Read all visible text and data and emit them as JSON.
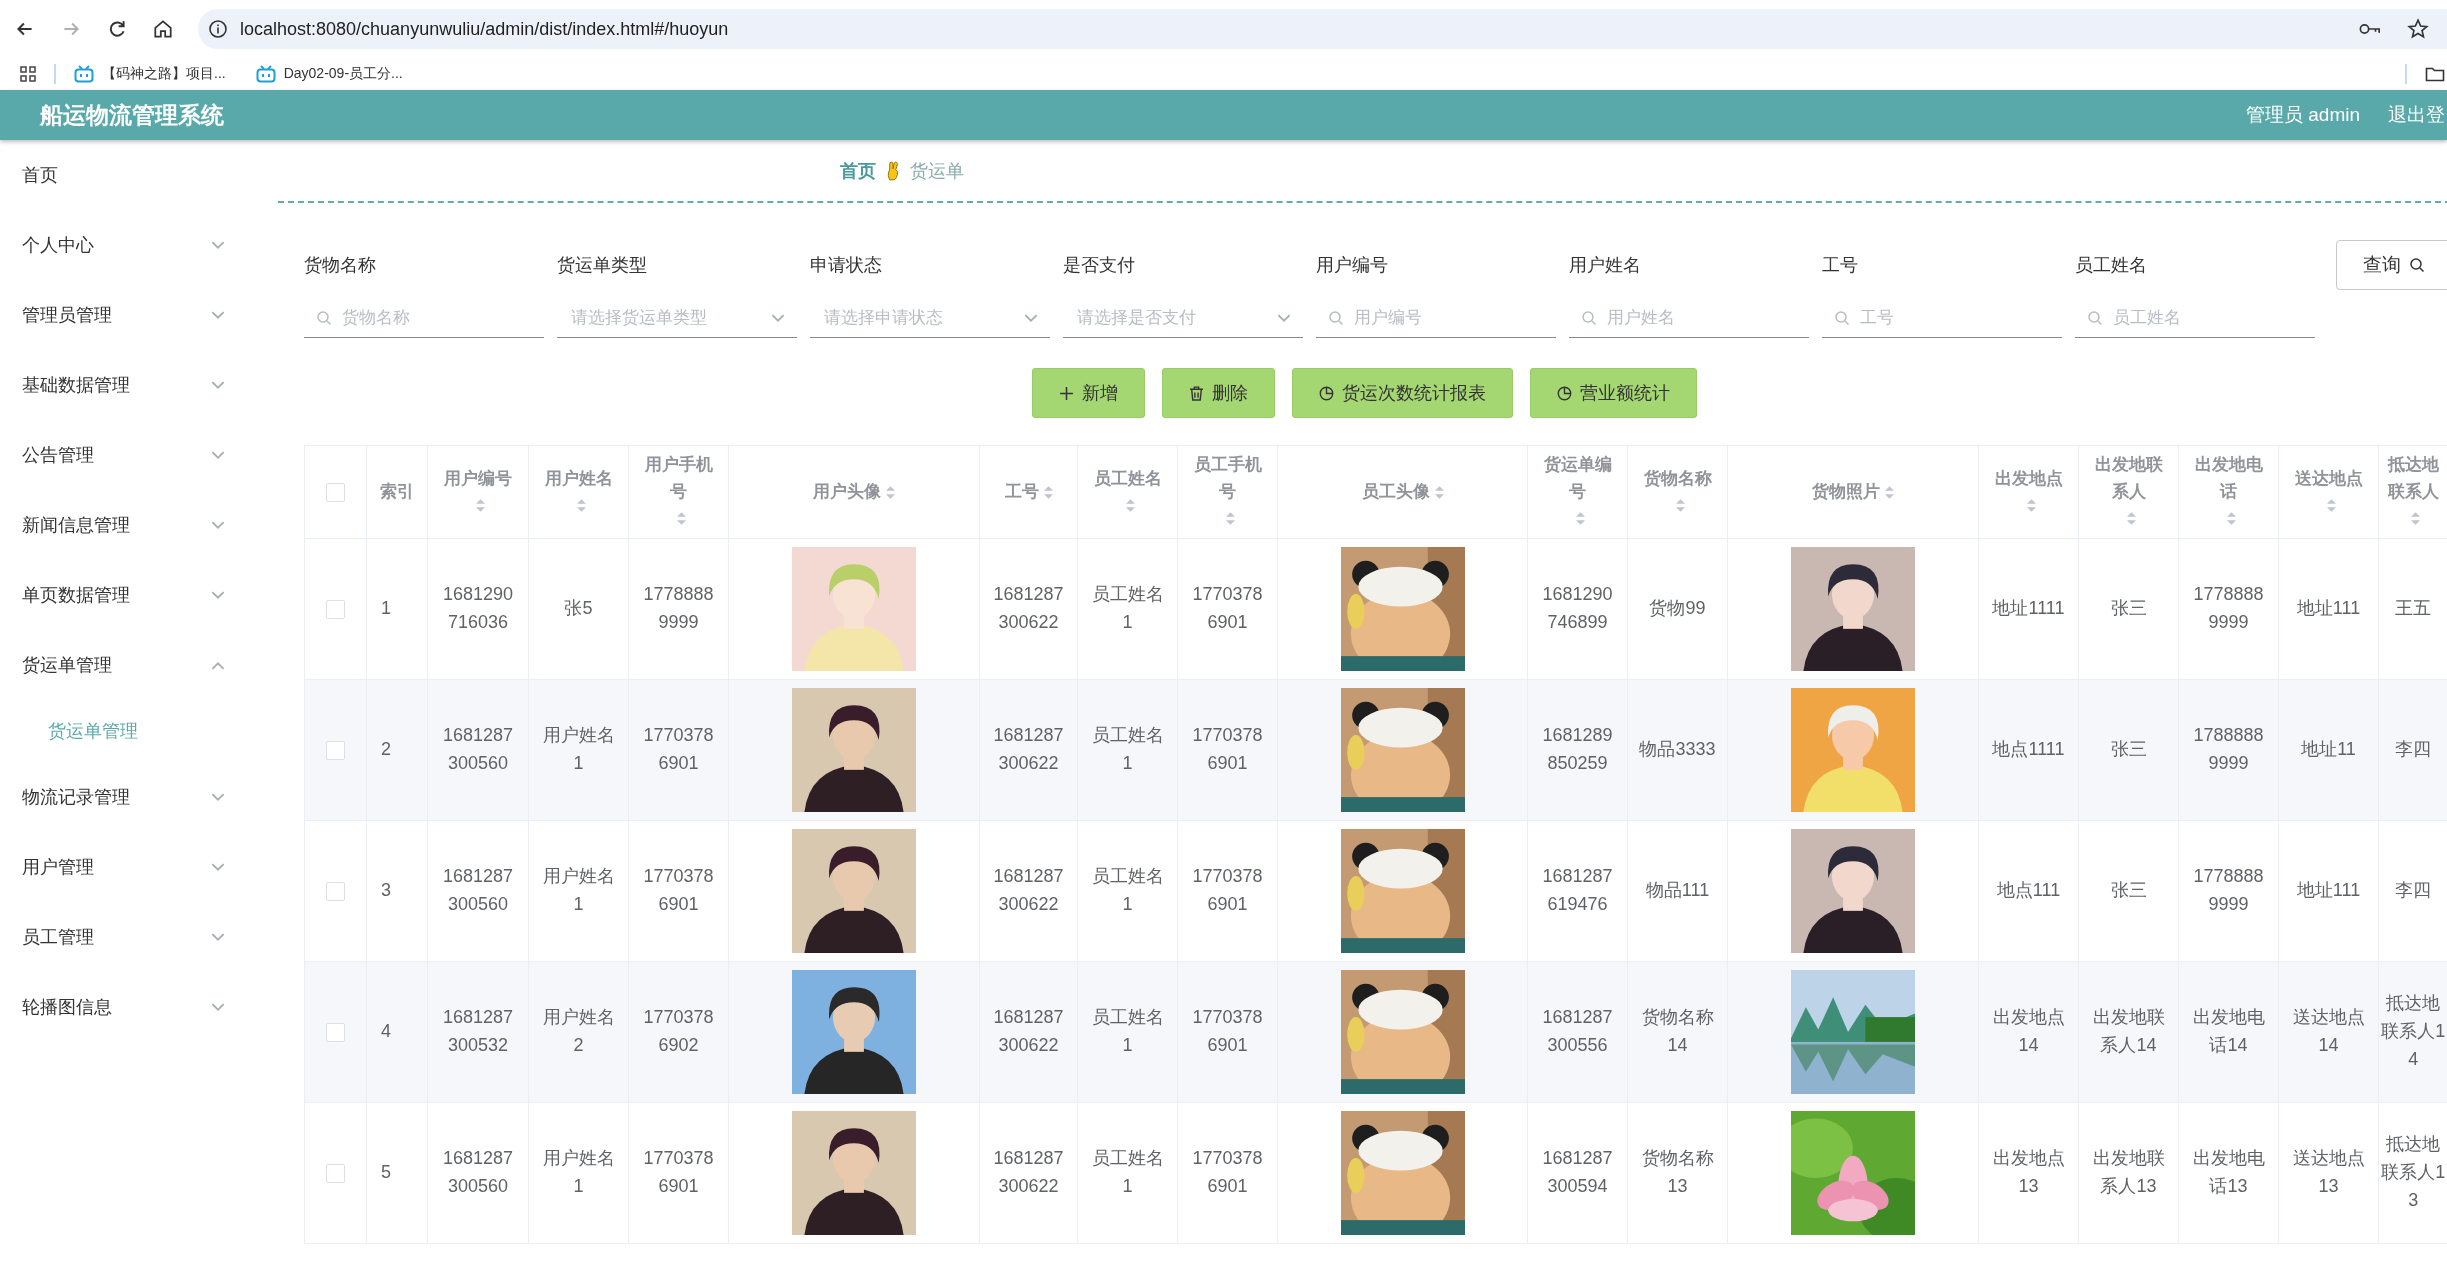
{
  "browser": {
    "url": "localhost:8080/chuanyunwuliu/admin/dist/index.html#/huoyun",
    "forward_disabled": true,
    "bookmarks": [
      "【码神之路】项目...",
      "Day02-09-员工分..."
    ]
  },
  "header": {
    "title": "船运物流管理系统",
    "user": "管理员 admin",
    "logout": "退出登"
  },
  "sidebar": {
    "items": [
      {
        "label": "首页"
      },
      {
        "label": "个人中心",
        "expanded": false
      },
      {
        "label": "管理员管理",
        "expanded": false
      },
      {
        "label": "基础数据管理",
        "expanded": false
      },
      {
        "label": "公告管理",
        "expanded": false
      },
      {
        "label": "新闻信息管理",
        "expanded": false
      },
      {
        "label": "单页数据管理",
        "expanded": false
      },
      {
        "label": "货运单管理",
        "expanded": true,
        "children": [
          {
            "label": "货运单管理",
            "selected": true
          }
        ]
      },
      {
        "label": "物流记录管理",
        "expanded": false
      },
      {
        "label": "用户管理",
        "expanded": false
      },
      {
        "label": "员工管理",
        "expanded": false
      },
      {
        "label": "轮播图信息",
        "expanded": false
      }
    ]
  },
  "breadcrumb": [
    {
      "label": "首页",
      "selected": true
    },
    {
      "label": "货运单",
      "selected": false
    }
  ],
  "filters": [
    {
      "label": "货物名称",
      "kind": "text",
      "placeholder": "货物名称"
    },
    {
      "label": "货运单类型",
      "kind": "select",
      "placeholder": "请选择货运单类型"
    },
    {
      "label": "申请状态",
      "kind": "select",
      "placeholder": "请选择申请状态"
    },
    {
      "label": "是否支付",
      "kind": "select",
      "placeholder": "请选择是否支付"
    },
    {
      "label": "用户编号",
      "kind": "text",
      "placeholder": "用户编号"
    },
    {
      "label": "用户姓名",
      "kind": "text",
      "placeholder": "用户姓名"
    },
    {
      "label": "工号",
      "kind": "text",
      "placeholder": "工号"
    },
    {
      "label": "员工姓名",
      "kind": "text",
      "placeholder": "员工姓名"
    }
  ],
  "query_button": "查询",
  "actions": [
    {
      "label": "新增",
      "kind": "add"
    },
    {
      "label": "删除",
      "kind": "delete"
    },
    {
      "label": "货运次数统计报表",
      "kind": "chart"
    },
    {
      "label": "营业额统计",
      "kind": "chart"
    }
  ],
  "table": {
    "all_checked": false,
    "columns": [
      {
        "label": "索引",
        "sortable": false
      },
      {
        "label": "用户编号",
        "sortable": true
      },
      {
        "label": "用户姓名",
        "sortable": true
      },
      {
        "label": "用户手机号",
        "sortable": true
      },
      {
        "label": "用户头像",
        "sortable": true
      },
      {
        "label": "工号",
        "sortable": true
      },
      {
        "label": "员工姓名",
        "sortable": true
      },
      {
        "label": "员工手机号",
        "sortable": true
      },
      {
        "label": "员工头像",
        "sortable": true
      },
      {
        "label": "货运单编号",
        "sortable": true
      },
      {
        "label": "货物名称",
        "sortable": true
      },
      {
        "label": "货物照片",
        "sortable": true
      },
      {
        "label": "出发地点",
        "sortable": true
      },
      {
        "label": "出发地联系人",
        "sortable": true
      },
      {
        "label": "出发地电话",
        "sortable": true
      },
      {
        "label": "送达地点",
        "sortable": true
      },
      {
        "label": "抵达地联系人",
        "sortable": true
      }
    ],
    "rows": [
      {
        "selected": false,
        "cells": [
          "1",
          "1681290716036",
          "张5",
          "17788889999",
          {
            "kind": "picture"
          },
          "1681287300622",
          "员工姓名1",
          "17703786901",
          {
            "kind": "picture"
          },
          "1681290746899",
          "货物99",
          {
            "kind": "picture"
          },
          "地址1111",
          "张三",
          "17788889999",
          "地址111",
          "王五"
        ]
      },
      {
        "selected": false,
        "cells": [
          "2",
          "1681287300560",
          "用户姓名1",
          "17703786901",
          {
            "kind": "picture"
          },
          "1681287300622",
          "员工姓名1",
          "17703786901",
          {
            "kind": "picture"
          },
          "1681289850259",
          "物品3333",
          {
            "kind": "picture"
          },
          "地点1111",
          "张三",
          "17888889999",
          "地址11",
          "李四"
        ]
      },
      {
        "selected": false,
        "cells": [
          "3",
          "1681287300560",
          "用户姓名1",
          "17703786901",
          {
            "kind": "picture"
          },
          "1681287300622",
          "员工姓名1",
          "17703786901",
          {
            "kind": "picture"
          },
          "1681287619476",
          "物品111",
          {
            "kind": "picture"
          },
          "地点111",
          "张三",
          "17788889999",
          "地址111",
          "李四"
        ]
      },
      {
        "selected": false,
        "cells": [
          "4",
          "1681287300532",
          "用户姓名2",
          "17703786902",
          {
            "kind": "picture"
          },
          "1681287300622",
          "员工姓名1",
          "17703786901",
          {
            "kind": "picture"
          },
          "1681287300556",
          "货物名称14",
          {
            "kind": "picture"
          },
          "出发地点14",
          "出发地联系人14",
          "出发地电话14",
          "送达地点14",
          "抵达地联系人14"
        ]
      },
      {
        "selected": false,
        "cells": [
          "5",
          "1681287300560",
          "用户姓名1",
          "17703786901",
          {
            "kind": "picture"
          },
          "1681287300622",
          "员工姓名1",
          "17703786901",
          {
            "kind": "picture"
          },
          "1681287300594",
          "货物名称13",
          {
            "kind": "picture"
          },
          "出发地点13",
          "出发地联系人13",
          "出发地电话13",
          "送达地点13",
          "抵达地联系人13"
        ]
      }
    ]
  }
}
